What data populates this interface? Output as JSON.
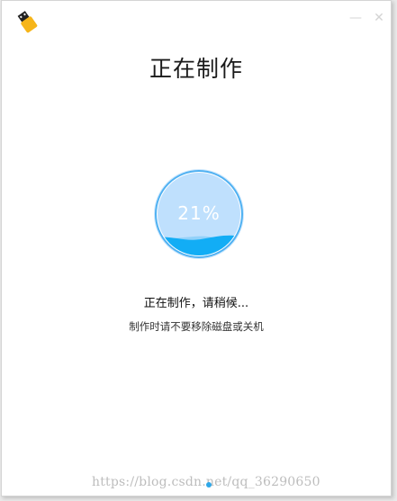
{
  "dialog": {
    "title": "正在制作",
    "status": "正在制作，请稍候...",
    "hint": "制作时请不要移除磁盘或关机"
  },
  "window_controls": {
    "minimize": "—",
    "close": "✕"
  },
  "progress": {
    "percent_label": "21%",
    "value": 0.21
  },
  "watermark": "https://blog.csdn.net/qq_36290650",
  "colors": {
    "ring": "#4fb1f2",
    "circle_fill": "#bfe0fd",
    "water": "#12adf5",
    "watermark_dot": "#2ea7e8"
  },
  "icons": {
    "app": "usb-drive-icon",
    "minimize": "minimize-icon",
    "close": "close-icon"
  }
}
